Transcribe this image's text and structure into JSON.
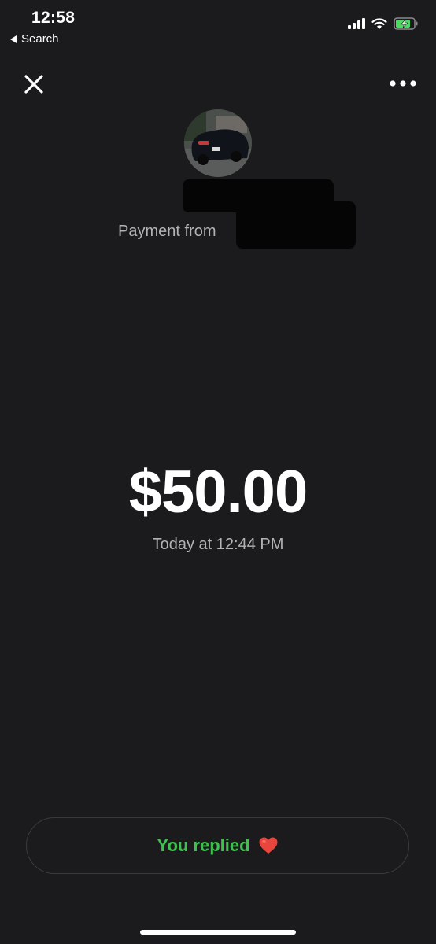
{
  "status_bar": {
    "time": "12:58",
    "back_label": "Search",
    "icons": [
      "cellular-signal-icon",
      "wifi-icon",
      "battery-charging-icon"
    ]
  },
  "header": {
    "close_icon": "close-icon",
    "more_icon": "more-dots-icon"
  },
  "payment": {
    "from_label": "Payment from",
    "amount": "$50.00",
    "timestamp": "Today at 12:44 PM"
  },
  "reply": {
    "label": "You replied",
    "emoji": "❤️"
  },
  "colors": {
    "background": "#1b1b1d",
    "reply_green": "#3ec24e",
    "secondary_text": "#b3b3b5"
  }
}
